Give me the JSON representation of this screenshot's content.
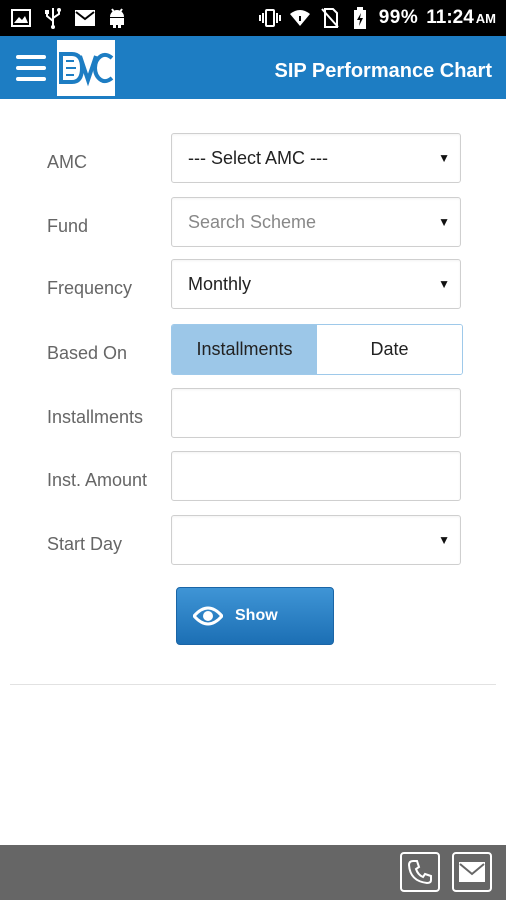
{
  "status_bar": {
    "battery": "99%",
    "time": "11:24",
    "ampm": "AM",
    "icons": [
      "image-icon",
      "usb-icon",
      "mail-icon",
      "android-icon",
      "vibrate-icon",
      "wifi-icon",
      "no-sim-icon",
      "battery-charging-icon"
    ]
  },
  "header": {
    "title": "SIP Performance Chart",
    "logo_text": "DVC",
    "color": "#1d7dc3"
  },
  "form": {
    "amc": {
      "label": "AMC",
      "value": "--- Select AMC ---"
    },
    "fund": {
      "label": "Fund",
      "placeholder": "Search Scheme"
    },
    "frequency": {
      "label": "Frequency",
      "value": "Monthly"
    },
    "based_on": {
      "label": "Based On",
      "options": [
        "Installments",
        "Date"
      ],
      "selected": "Installments"
    },
    "installments": {
      "label": "Installments",
      "value": ""
    },
    "inst_amount": {
      "label": "Inst. Amount",
      "value": ""
    },
    "start_day": {
      "label": "Start Day",
      "value": ""
    },
    "show_button": "Show"
  },
  "footer": {
    "icons": [
      "phone-icon",
      "mail-icon"
    ]
  }
}
